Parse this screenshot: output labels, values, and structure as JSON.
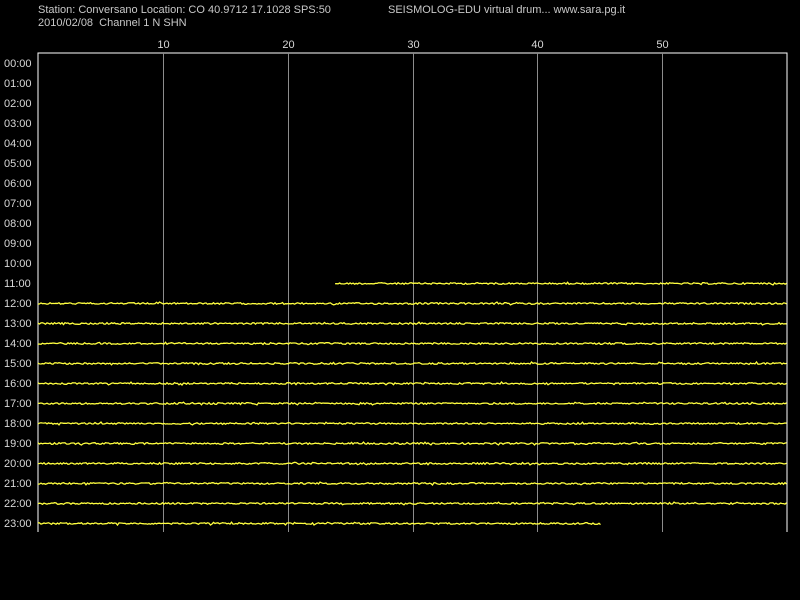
{
  "header": {
    "station_line": "Station: Conversano Location: CO 40.9712 17.1028 SPS:50",
    "app_line": "SEISMOLOG-EDU virtual drum... www.sara.pg.it",
    "date_line": "2010/02/08  Channel 1 N SHN"
  },
  "colors": {
    "background": "#000000",
    "frame": "#ffffff",
    "grid": "#8c8c8c",
    "trace": "#ffff40",
    "text": "#d0d0d0"
  },
  "chart_data": {
    "type": "line",
    "title": "",
    "xlabel": "",
    "ylabel": "",
    "xlim": [
      0,
      60
    ],
    "x_ticks": [
      10,
      20,
      30,
      40,
      50
    ],
    "x_tick_labels": [
      "10",
      "20",
      "30",
      "40",
      "50"
    ],
    "rows": [
      "00:00",
      "01:00",
      "02:00",
      "03:00",
      "04:00",
      "05:00",
      "06:00",
      "07:00",
      "08:00",
      "09:00",
      "10:00",
      "11:00",
      "12:00",
      "13:00",
      "14:00",
      "15:00",
      "16:00",
      "17:00",
      "18:00",
      "19:00",
      "20:00",
      "21:00",
      "22:00",
      "23:00"
    ],
    "grid": true,
    "traces": [
      {
        "row": "11:00",
        "start_min": 23.8,
        "end_min": 60
      },
      {
        "row": "12:00",
        "start_min": 0,
        "end_min": 60
      },
      {
        "row": "13:00",
        "start_min": 0,
        "end_min": 60
      },
      {
        "row": "14:00",
        "start_min": 0,
        "end_min": 60
      },
      {
        "row": "15:00",
        "start_min": 0,
        "end_min": 60
      },
      {
        "row": "16:00",
        "start_min": 0,
        "end_min": 60
      },
      {
        "row": "17:00",
        "start_min": 0,
        "end_min": 60
      },
      {
        "row": "18:00",
        "start_min": 0,
        "end_min": 60
      },
      {
        "row": "19:00",
        "start_min": 0,
        "end_min": 60
      },
      {
        "row": "20:00",
        "start_min": 0,
        "end_min": 60
      },
      {
        "row": "21:00",
        "start_min": 0,
        "end_min": 60
      },
      {
        "row": "22:00",
        "start_min": 0,
        "end_min": 60
      },
      {
        "row": "23:00",
        "start_min": 0,
        "end_min": 45.1
      }
    ]
  }
}
